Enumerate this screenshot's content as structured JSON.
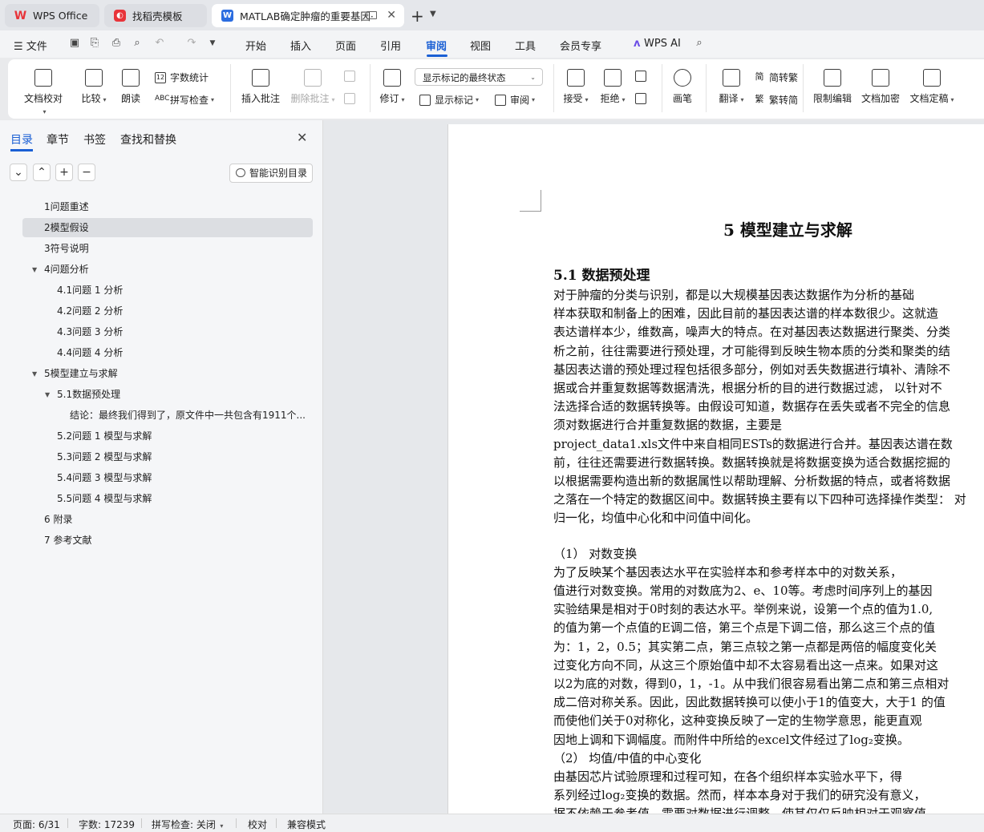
{
  "tabs": [
    {
      "label": "WPS Office",
      "icon": "wps-logo-icon"
    },
    {
      "label": "找稻壳模板",
      "icon": "docer-icon"
    },
    {
      "label": "MATLAB确定肿瘤的重要基因·",
      "icon": "word-doc-icon"
    }
  ],
  "menu": {
    "file": "文件",
    "items": [
      "开始",
      "插入",
      "页面",
      "引用",
      "审阅",
      "视图",
      "工具",
      "会员专享"
    ],
    "active": "审阅",
    "ai": "WPS AI"
  },
  "ribbon": {
    "proofread": "文档校对",
    "compare": "比较",
    "read_aloud": "朗读",
    "word_count": "字数统计",
    "spell_check": "拼写检查",
    "insert_comment": "插入批注",
    "delete_comment": "删除批注",
    "revise": "修订",
    "markup_state": "显示标记的最终状态",
    "show_markup": "显示标记",
    "review": "审阅",
    "accept": "接受",
    "reject": "拒绝",
    "pen": "画笔",
    "translate": "翻译",
    "to_traditional": "简转繁",
    "to_simplified": "繁转简",
    "restrict_edit": "限制编辑",
    "encrypt": "文档加密",
    "finalize": "文档定稿"
  },
  "nav": {
    "tabs": [
      "目录",
      "章节",
      "书签",
      "查找和替换"
    ],
    "smart_toc": "智能识别目录",
    "toc": [
      {
        "text": "1问题重述",
        "level": 1
      },
      {
        "text": "2模型假设",
        "level": 1,
        "selected": true
      },
      {
        "text": "3符号说明",
        "level": 1
      },
      {
        "text": "4问题分析",
        "level": 1,
        "expanded": true
      },
      {
        "text": "4.1问题 1 分析",
        "level": 2
      },
      {
        "text": "4.2问题 2 分析",
        "level": 2
      },
      {
        "text": "4.3问题 3 分析",
        "level": 2
      },
      {
        "text": "4.4问题 4 分析",
        "level": 2
      },
      {
        "text": "5模型建立与求解",
        "level": 1,
        "expanded": true
      },
      {
        "text": "5.1数据预处理",
        "level": 2,
        "expanded": true
      },
      {
        "text": "结论：最终我们得到了，原文件中一共包含有1911个...",
        "level": 3
      },
      {
        "text": "5.2问题 1 模型与求解",
        "level": 2
      },
      {
        "text": "5.3问题 2 模型与求解",
        "level": 2
      },
      {
        "text": "5.4问题 3 模型与求解",
        "level": 2
      },
      {
        "text": "5.5问题 4 模型与求解",
        "level": 2
      },
      {
        "text": "6 附录",
        "level": 1
      },
      {
        "text": "7 参考文献",
        "level": 1
      }
    ]
  },
  "document": {
    "heading1": "5  模型建立与求解",
    "heading2": "5.1  数据预处理",
    "lines": [
      "    对于肿瘤的分类与识别，都是以大规模基因表达数据作为分析的基础",
      "样本获取和制备上的困难，因此目前的基因表达谱的样本数很少。这就造",
      "表达谱样本少，维数高，噪声大的特点。在对基因表达数据进行聚类、分类",
      "析之前，往往需要进行预处理，才可能得到反映生物本质的分类和聚类的结",
      "基因表达谱的预处理过程包括很多部分，例如对丢失数据进行填补、清除不",
      "据或合并重复数据等数据清洗，根据分析的目的进行数据过滤，  以针对不",
      "法选择合适的数据转换等。由假设可知道，数据存在丢失或者不完全的信息",
      "须对数据进行合并重复数据的数据，主要是",
      "project_data1.xls文件中来自相同ESTs的数据进行合并。基因表达谱在数",
      "前，往往还需要进行数据转换。数据转换就是将数据变换为适合数据挖掘的",
      "以根据需要构造出新的数据属性以帮助理解、分析数据的特点，或者将数据",
      "之落在一个特定的数据区间中。数据转换主要有以下四种可选择操作类型：  对",
      "归一化，均值中心化和中问值中间化。",
      "",
      "（1）  对数变换",
      "    为了反映某个基因表达水平在实验样本和参考样本中的对数关系，",
      "值进行对数变换。常用的对数底为2、e、10等。考虑时间序列上的基因",
      "实验结果是相对于0时刻的表达水平。举例来说，设第一个点的值为1.0,",
      "的值为第一个点值的E调二倍，第三个点是下调二倍，那么这三个点的值",
      "为：1，2，0.5；其实第二点，第三点较之第一点都是两倍的幅度变化关",
      "过变化方向不同，从这三个原始值中却不太容易看出这一点来。如果对这",
      "以2为底的对数，得到0，1，-1。从中我们很容易看出第二点和第三点相对",
      "成二倍对称关系。因此，因此数据转换可以使小于1的值变大，大于1 的值",
      "而使他们关于0对称化，这种变换反映了一定的生物学意思，能更直观",
      "因地上调和下调幅度。而附件中所给的excel文件经过了log₂变换。",
      "（2）  均值/中值的中心变化",
      "    由基因芯片试验原理和过程可知，在各个组织样本实验水平下，得",
      "系列经过log₂变换的数据。然而，样本本身对于我们的研究没有意义，",
      "据不依赖于参考值，需要对数据进行调整，使其仅仅反映相对于观察值"
    ]
  },
  "status": {
    "page": "页面: 6/31",
    "words": "字数: 17239",
    "spell": "拼写检查: 关闭",
    "proof": "校对",
    "compat": "兼容模式"
  },
  "colors": {
    "accent": "#1a5fd4",
    "wps_red": "#e8343a"
  }
}
